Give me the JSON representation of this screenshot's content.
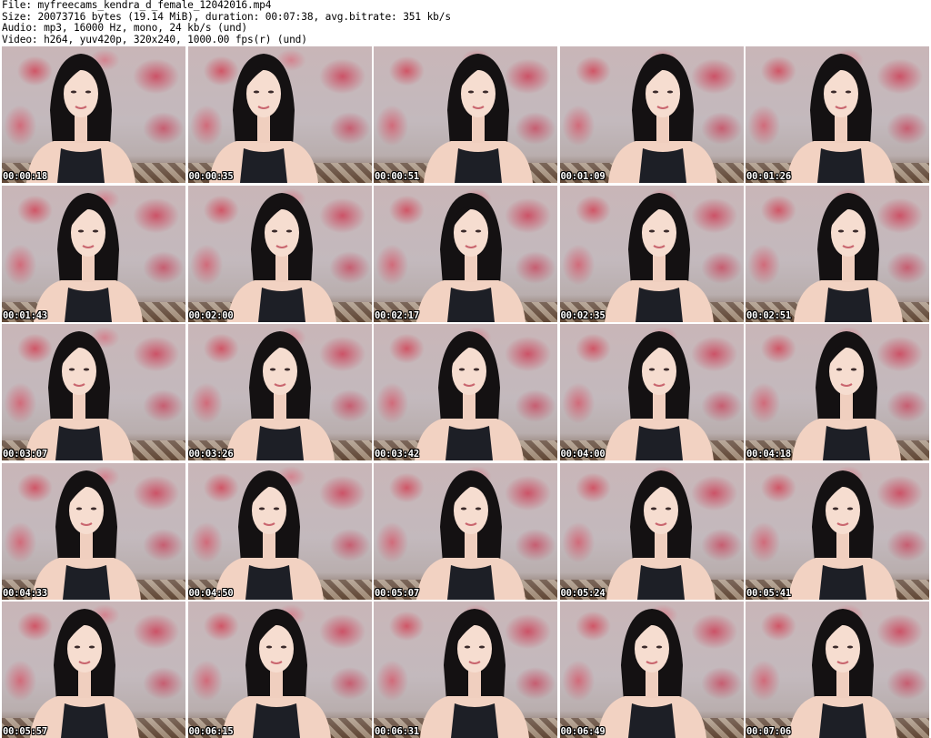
{
  "header": {
    "file_line": "File: myfreecams_kendra_d_female_12042016.mp4",
    "size_line": "Size: 20073716 bytes (19.14 MiB), duration: 00:07:38, avg.bitrate: 351 kb/s",
    "audio_line": "Audio: mp3, 16000 Hz, mono, 24 kb/s (und)",
    "video_line": "Video: h264, yuv420p, 320x240, 1000.00 fps(r) (und)"
  },
  "thumbnails": [
    {
      "timestamp": "00:00:18"
    },
    {
      "timestamp": "00:00:35"
    },
    {
      "timestamp": "00:00:51"
    },
    {
      "timestamp": "00:01:09"
    },
    {
      "timestamp": "00:01:26"
    },
    {
      "timestamp": "00:01:43"
    },
    {
      "timestamp": "00:02:00"
    },
    {
      "timestamp": "00:02:17"
    },
    {
      "timestamp": "00:02:35"
    },
    {
      "timestamp": "00:02:51"
    },
    {
      "timestamp": "00:03:07"
    },
    {
      "timestamp": "00:03:26"
    },
    {
      "timestamp": "00:03:42"
    },
    {
      "timestamp": "00:04:00"
    },
    {
      "timestamp": "00:04:18"
    },
    {
      "timestamp": "00:04:33"
    },
    {
      "timestamp": "00:04:50"
    },
    {
      "timestamp": "00:05:07"
    },
    {
      "timestamp": "00:05:24"
    },
    {
      "timestamp": "00:05:41"
    },
    {
      "timestamp": "00:05:57"
    },
    {
      "timestamp": "00:06:15"
    },
    {
      "timestamp": "00:06:31"
    },
    {
      "timestamp": "00:06:49"
    },
    {
      "timestamp": "00:07:06"
    }
  ]
}
